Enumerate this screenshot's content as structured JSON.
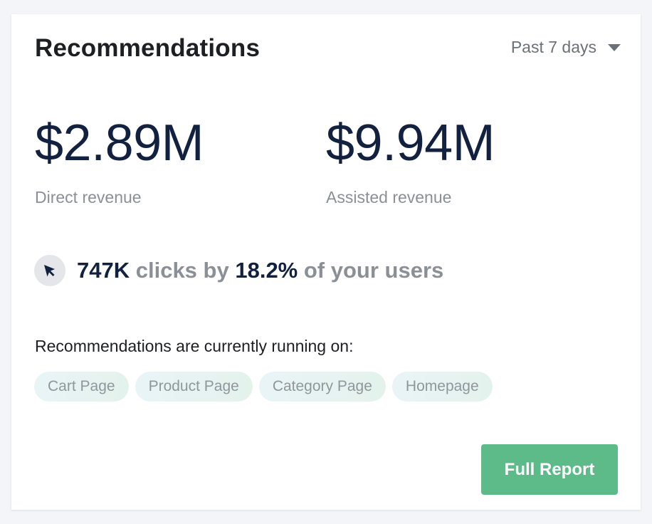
{
  "card": {
    "title": "Recommendations",
    "period": {
      "selected": "Past 7 days",
      "icon": "caret-down-icon"
    }
  },
  "metrics": {
    "direct": {
      "value": "$2.89M",
      "label": "Direct revenue"
    },
    "assisted": {
      "value": "$9.94M",
      "label": "Assisted revenue"
    }
  },
  "clicks": {
    "icon": "cursor-icon",
    "count": "747K",
    "middle_text": "clicks by",
    "percent": "18.2%",
    "suffix_text": "of your users"
  },
  "running": {
    "label": "Recommendations are currently running on:",
    "pages": [
      "Cart Page",
      "Product Page",
      "Category Page",
      "Homepage"
    ]
  },
  "actions": {
    "full_report_label": "Full Report"
  },
  "colors": {
    "accent": "#5dbb89",
    "metric_text": "#12213f",
    "muted_text": "#8b9096"
  }
}
